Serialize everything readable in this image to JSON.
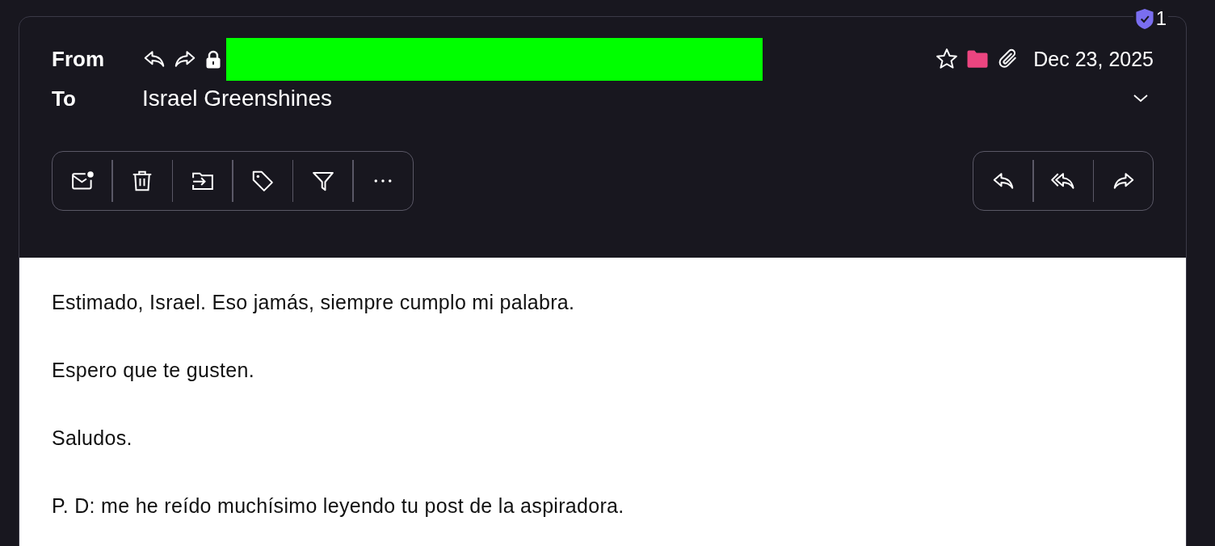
{
  "security_badge": {
    "count": "1"
  },
  "header": {
    "from_label": "From",
    "to_label": "To",
    "recipient": "Israel Greenshines",
    "date": "Dec 23, 2025"
  },
  "body": {
    "paragraphs": [
      "Estimado, Israel. Eso jamás, siempre cumplo mi palabra.",
      "Espero que te gusten.",
      "Saludos.",
      "P. D: me he reído muchísimo leyendo tu post de la aspiradora."
    ]
  }
}
